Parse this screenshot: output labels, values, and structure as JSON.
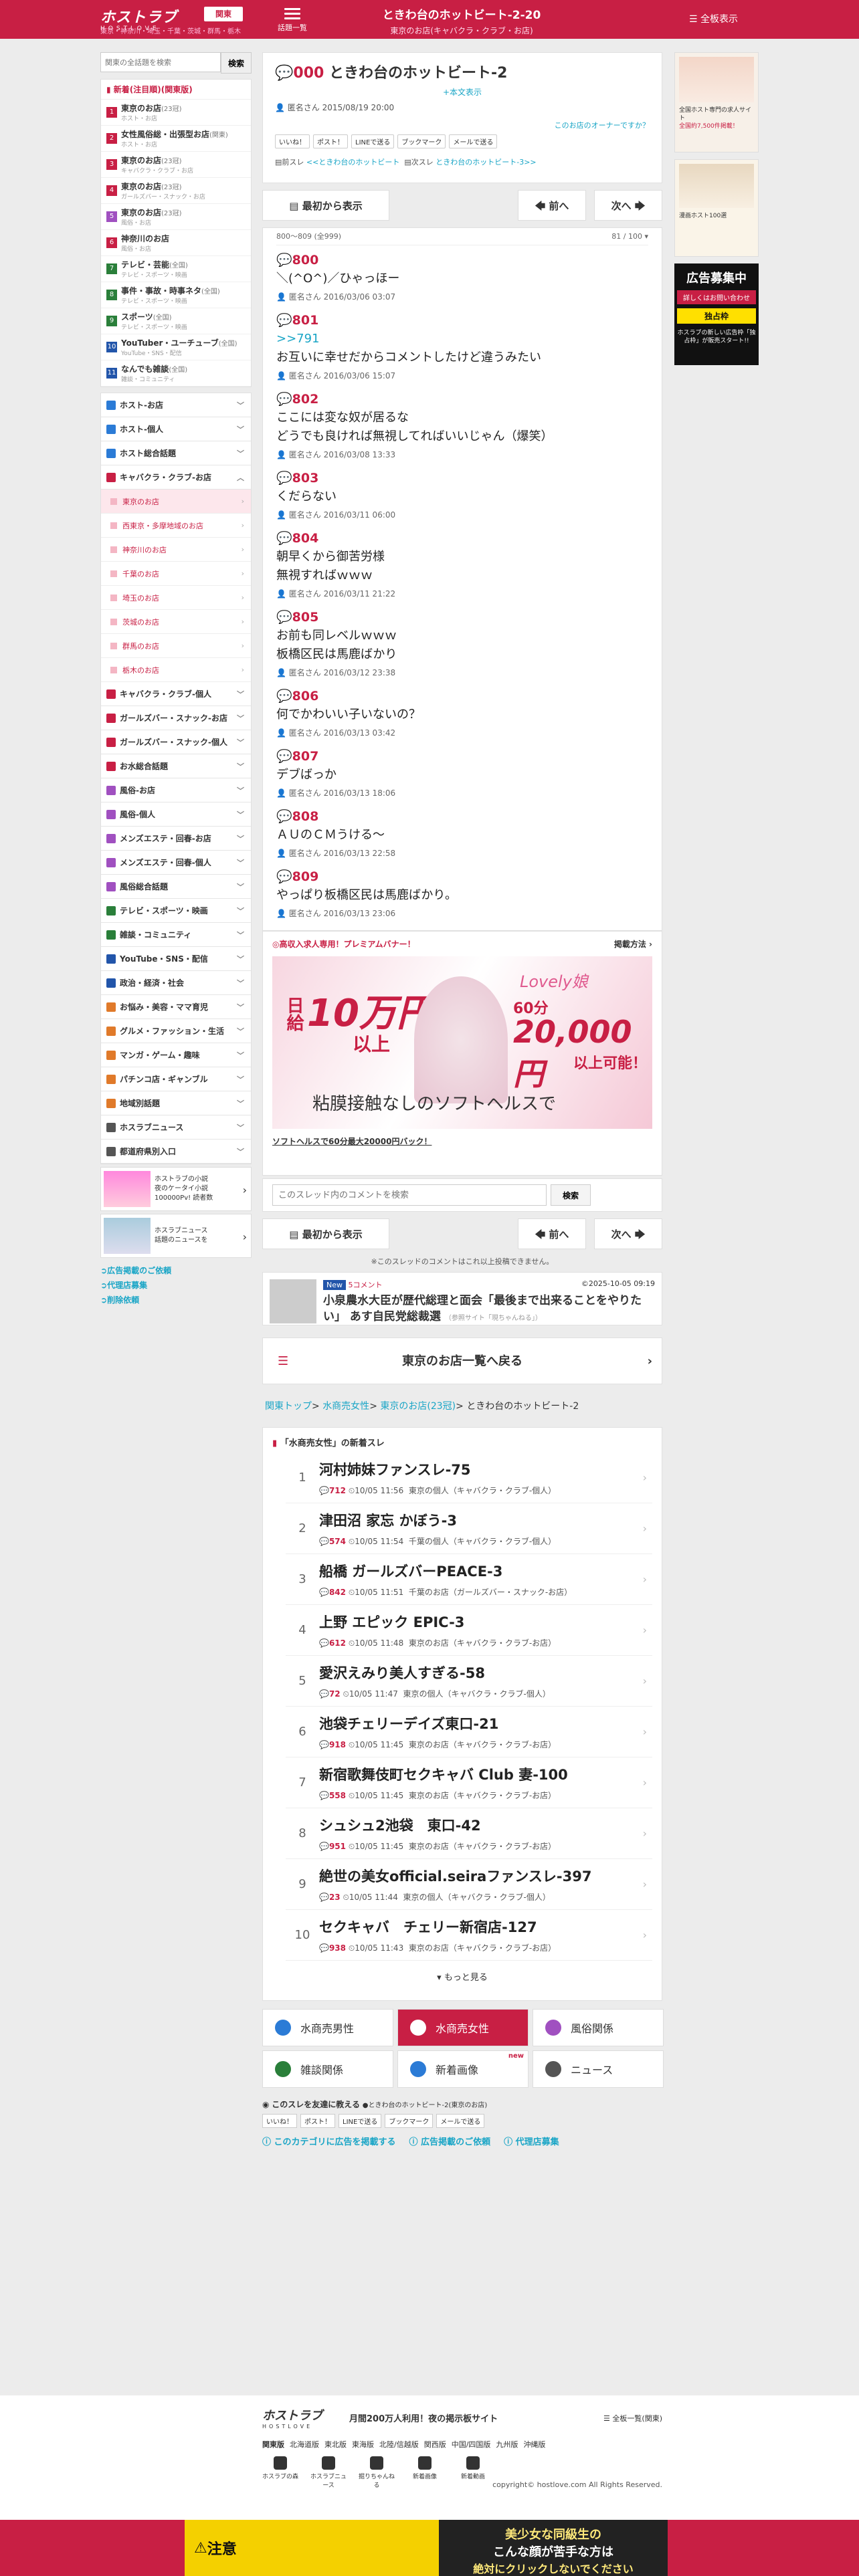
{
  "header": {
    "logo": "ホストラブ",
    "logo_sub": "HOSTLOVE",
    "area_btn": "関東",
    "area_sub": "東京・神奈川・埼玉・千葉・茨城・群馬・栃木",
    "menu": "話題一覧",
    "title": "ときわ台のホットビート-2-20",
    "subtitle": "東京のお店(キャバクラ・クラブ・お店)",
    "full": "全板表示"
  },
  "search": {
    "placeholder": "関東の全話題を検索",
    "btn": "検索"
  },
  "left": {
    "newhead": "新着(注目順)(関東版)",
    "newitems": [
      {
        "n": "1",
        "c": "#c81f44",
        "t": "東京のお店",
        "k": "(23冠)",
        "s": "ホスト・お店"
      },
      {
        "n": "2",
        "c": "#c81f44",
        "t": "女性風俗総・出張型お店",
        "k": "(関東)",
        "s": "ホスト・お店"
      },
      {
        "n": "3",
        "c": "#c81f44",
        "t": "東京のお店",
        "k": "(23冠)",
        "s": "キャバクラ・クラブ・お店"
      },
      {
        "n": "4",
        "c": "#c81f44",
        "t": "東京のお店",
        "k": "(23冠)",
        "s": "ガールズバー・スナック・お店"
      },
      {
        "n": "5",
        "c": "#a050c0",
        "t": "東京のお店",
        "k": "(23冠)",
        "s": "風俗・お店"
      },
      {
        "n": "6",
        "c": "#c81f44",
        "t": "神奈川のお店",
        "k": "",
        "s": "風俗・お店"
      },
      {
        "n": "7",
        "c": "#2a7f3a",
        "t": "テレビ・芸能",
        "k": "(全国)",
        "s": "テレビ・スポーツ・映画"
      },
      {
        "n": "8",
        "c": "#2a7f3a",
        "t": "事件・事故・時事ネタ",
        "k": "(全国)",
        "s": "テレビ・スポーツ・映画"
      },
      {
        "n": "9",
        "c": "#2a7f3a",
        "t": "スポーツ",
        "k": "(全国)",
        "s": "テレビ・スポーツ・映画"
      },
      {
        "n": "10",
        "c": "#2255aa",
        "t": "YouTuber・ユーチューブ",
        "k": "(全国)",
        "s": "YouTube・SNS・配信"
      },
      {
        "n": "11",
        "c": "#2255aa",
        "t": "なんでも雑談",
        "k": "(全国)",
        "s": "雑談・コミュニティ"
      }
    ],
    "cats_top": [
      {
        "t": "ホスト-お店",
        "c": "#2b7bd6"
      },
      {
        "t": "ホスト-個人",
        "c": "#2b7bd6"
      },
      {
        "t": "ホスト総合話題",
        "c": "#2b7bd6"
      },
      {
        "t": "キャバクラ・クラブ-お店",
        "c": "#c81f44"
      }
    ],
    "subs": [
      "東京のお店",
      "西東京・多摩地域のお店",
      "神奈川のお店",
      "千葉のお店",
      "埼玉のお店",
      "茨城のお店",
      "群馬のお店",
      "栃木のお店"
    ],
    "cats_bottom": [
      {
        "t": "キャバクラ・クラブ-個人",
        "c": "#c81f44"
      },
      {
        "t": "ガールズバー・スナック-お店",
        "c": "#c81f44"
      },
      {
        "t": "ガールズバー・スナック-個人",
        "c": "#c81f44"
      },
      {
        "t": "お水総合話題",
        "c": "#c81f44"
      },
      {
        "t": "風俗-お店",
        "c": "#a050c0"
      },
      {
        "t": "風俗-個人",
        "c": "#a050c0"
      },
      {
        "t": "メンズエステ・回春-お店",
        "c": "#a050c0"
      },
      {
        "t": "メンズエステ・回春-個人",
        "c": "#a050c0"
      },
      {
        "t": "風俗総合話題",
        "c": "#a050c0"
      },
      {
        "t": "テレビ・スポーツ・映画",
        "c": "#2a7f3a"
      },
      {
        "t": "雑談・コミュニティ",
        "c": "#2a7f3a"
      },
      {
        "t": "YouTube・SNS・配信",
        "c": "#2255aa"
      },
      {
        "t": "政治・経済・社会",
        "c": "#2255aa"
      },
      {
        "t": "お悩み・美容・ママ育児",
        "c": "#e07a2a"
      },
      {
        "t": "グルメ・ファッション・生活",
        "c": "#e07a2a"
      },
      {
        "t": "マンガ・ゲーム・趣味",
        "c": "#e07a2a"
      },
      {
        "t": "パチンコ店・ギャンブル",
        "c": "#e07a2a"
      },
      {
        "t": "地域別話題",
        "c": "#e07a2a"
      },
      {
        "t": "ホスラブニュース",
        "c": "#555555"
      },
      {
        "t": "都道府県別入口",
        "c": "#555555"
      }
    ],
    "promo1": "ホストラブの小説\n夜のケータイ小説\n100000Pv! 読者数",
    "promo2": "ホスラブニュース\n話題のニュースを",
    "links": [
      "広告掲載のご依頼",
      "代理店募集",
      "削除依頼"
    ]
  },
  "thread": {
    "icon": "💬",
    "no": "000",
    "title": "ときわ台のホットビート-2",
    "honbun": "+本文表示",
    "meta": "匿名さん 2015/08/19 20:00",
    "owner": "このお店のオーナーですか？",
    "shares": [
      "いいね！",
      "ポスト！",
      "LINEで送る",
      "ブックマーク",
      "メールで送る"
    ],
    "prev_label": "前スレ",
    "prev": "<<ときわ台のホットビート",
    "next_label": "次スレ",
    "next": "ときわ台のホットビート-3>>"
  },
  "nav": {
    "first": "最初から表示",
    "prev": "前へ",
    "next": "次へ"
  },
  "posts_hdr": {
    "range": "800～809 (全999)",
    "page": "81 / 100"
  },
  "posts": [
    {
      "no": "800",
      "body": "＼(^O^)／ひゃっほー",
      "meta": "匿名さん 2016/03/06 03:07"
    },
    {
      "no": "801",
      "rep": ">>791",
      "body": "お互いに幸せだからコメントしたけど違うみたい",
      "meta": "匿名さん 2016/03/06 15:07"
    },
    {
      "no": "802",
      "body": "ここには変な奴が居るな\nどうでも良ければ無視してればいいじゃん（爆笑）",
      "meta": "匿名さん 2016/03/08 13:33"
    },
    {
      "no": "803",
      "body": "くだらない",
      "meta": "匿名さん 2016/03/11 06:00"
    },
    {
      "no": "804",
      "body": "朝早くから御苦労様\n無視すればｗｗｗ",
      "meta": "匿名さん 2016/03/11 21:22"
    },
    {
      "no": "805",
      "body": "お前も同レベルｗｗｗ\n板橋区民は馬鹿ばかり",
      "meta": "匿名さん 2016/03/12 23:38"
    },
    {
      "no": "806",
      "body": "何でかわいい子いないの？",
      "meta": "匿名さん 2016/03/13 03:42"
    },
    {
      "no": "807",
      "body": "デブばっか",
      "meta": "匿名さん 2016/03/13 18:06"
    },
    {
      "no": "808",
      "body": "ＡＵのＣＭうける～",
      "meta": "匿名さん 2016/03/13 22:58"
    },
    {
      "no": "809",
      "body": "やっぱり板橋区民は馬鹿ばかり。",
      "meta": "匿名さん 2016/03/13 23:06"
    }
  ],
  "banner": {
    "head": "◎高収入求人専用！プレミアムバナー！",
    "side": "掲載方法 ›",
    "d1": "日給",
    "d2": "10万円",
    "d3": "以上",
    "d4": "60分",
    "d5": "20,000円",
    "d6": "以上可能！",
    "d7": "粘膜接触なしのソフトヘルスで",
    "brand": "Lovely娘",
    "caption": "ソフトヘルスで60分最大20000円バック！"
  },
  "csearch": {
    "placeholder": "このスレッド内のコメントを検索",
    "btn": "検索"
  },
  "note": "※このスレッドのコメントはこれ以上投稿できません。",
  "news": {
    "badge": "New",
    "comments": "5コメント",
    "date": "©2025-10-05 09:19",
    "title": "小泉農水大臣が歴代総理と面会「最後まで出来ることをやりたい」 あす自民党総裁選",
    "src": "（参照サイト「現ちゃんねる」）"
  },
  "back": "東京のお店一覧へ戻る",
  "crumb": {
    "a": "関東トップ",
    "b": "水商売女性",
    "c": "東京のお店",
    "cc": "(23冠)",
    "d": "ときわ台のホットビート-2"
  },
  "rank": {
    "head": "「水商売女性」の新着スレ",
    "items": [
      {
        "t": "河村姉妹ファンスレ-75",
        "c": "712",
        "d": "10/05 11:56",
        "cat": "東京の個人（キャバクラ・クラブ-個人）"
      },
      {
        "t": "津田沼 家忘 かぼう-3",
        "c": "574",
        "d": "10/05 11:54",
        "cat": "千葉の個人（キャバクラ・クラブ-個人）"
      },
      {
        "t": "船橋 ガールズバーPEACE-3",
        "c": "842",
        "d": "10/05 11:51",
        "cat": "千葉のお店（ガールズバー・スナック-お店）"
      },
      {
        "t": "上野 エピック EPIC-3",
        "c": "612",
        "d": "10/05 11:48",
        "cat": "東京のお店（キャバクラ・クラブ-お店）"
      },
      {
        "t": "愛沢えみり美人すぎる-58",
        "c": "72",
        "d": "10/05 11:47",
        "cat": "東京の個人（キャバクラ・クラブ-個人）"
      },
      {
        "t": "池袋チェリーデイズ東口-21",
        "c": "918",
        "d": "10/05 11:45",
        "cat": "東京のお店（キャバクラ・クラブ-お店）"
      },
      {
        "t": "新宿歌舞伎町セクキャバ Club 妻-100",
        "c": "558",
        "d": "10/05 11:45",
        "cat": "東京のお店（キャバクラ・クラブ-お店）"
      },
      {
        "t": "シュシュ2池袋　東口-42",
        "c": "951",
        "d": "10/05 11:45",
        "cat": "東京のお店（キャバクラ・クラブ-お店）"
      },
      {
        "t": "絶世の美女official.seiraファンスレ-397",
        "c": "23",
        "d": "10/05 11:44",
        "cat": "東京の個人（キャバクラ・クラブ-個人）"
      },
      {
        "t": "セクキャバ　チェリー新宿店-127",
        "c": "938",
        "d": "10/05 11:43",
        "cat": "東京のお店（キャバクラ・クラブ-お店）"
      }
    ],
    "more": "もっと見る"
  },
  "catbtns": [
    {
      "t": "水商売男性",
      "c": "#2b7bd6"
    },
    {
      "t": "水商売女性",
      "c": "#ffffff",
      "on": true
    },
    {
      "t": "風俗関係",
      "c": "#a050c0"
    },
    {
      "t": "雑談関係",
      "c": "#2a7f3a"
    },
    {
      "t": "新着画像",
      "c": "#2b7bd6",
      "new": "new"
    },
    {
      "t": "ニュース",
      "c": "#555555"
    }
  ],
  "tell": {
    "t": "このスレを友達に教える",
    "s": "●ときわ台のホットビート-2(東京のお店)",
    "shares": [
      "いいね！",
      "ポスト！",
      "LINEで送る",
      "ブックマーク",
      "メールで送る"
    ],
    "links": [
      "このカテゴリに広告を掲載する",
      "広告掲載のご依頼",
      "代理店募集"
    ]
  },
  "footer": {
    "logo": "ホストラブ",
    "logo_sub": "HOSTLOVE",
    "tag": "月間200万人利用！夜の掲示板サイト",
    "full": "全板一覧(関東)",
    "regions": [
      "関東版",
      "北海道版",
      "東北版",
      "東海版",
      "北陸/信越版",
      "関西版",
      "中国/四国版",
      "九州版",
      "沖縄版"
    ],
    "icons": [
      "ホスラブの森",
      "ホスラブニュース",
      "掘りちゃんねる",
      "新着画像",
      "新着動画"
    ],
    "copy": "copyright© hostlove.com All Rights Reserved."
  },
  "right": {
    "ad1": "全国ホスト専門の求人サイト",
    "ad2": "全国約7,500件掲載！",
    "ad3": "漫画ホスト100選",
    "rec": "広告募集中",
    "rec2": "詳しくはお問い合わせ",
    "rec3": "独占枠",
    "rec4": "ホスラブの新しい広告枠「独占枠」が販売スタート!!"
  },
  "adbar": {
    "a": "注意",
    "b": "美少女な同級生の",
    "c": "こんな顔が苦手な方は",
    "d": "絶対にクリックしないでください"
  }
}
